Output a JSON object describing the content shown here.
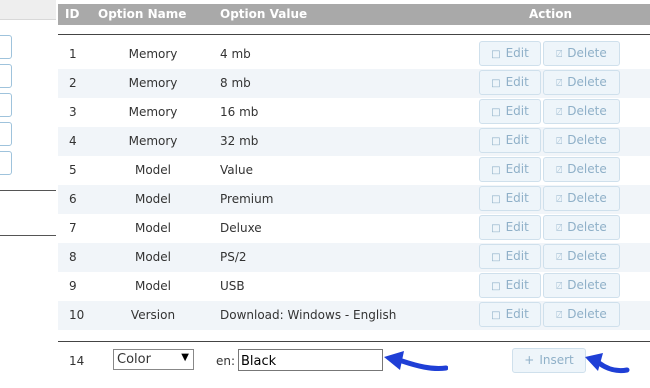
{
  "header": {
    "id": "ID",
    "option_name": "Option Name",
    "option_value": "Option Value",
    "action": "Action"
  },
  "rows": [
    {
      "id": "1",
      "name": "Memory",
      "value": "4 mb",
      "edit": "Edit",
      "delete": "Delete"
    },
    {
      "id": "2",
      "name": "Memory",
      "value": "8 mb",
      "edit": "Edit",
      "delete": "Delete"
    },
    {
      "id": "3",
      "name": "Memory",
      "value": "16 mb",
      "edit": "Edit",
      "delete": "Delete"
    },
    {
      "id": "4",
      "name": "Memory",
      "value": "32 mb",
      "edit": "Edit",
      "delete": "Delete"
    },
    {
      "id": "5",
      "name": "Model",
      "value": "Value",
      "edit": "Edit",
      "delete": "Delete"
    },
    {
      "id": "6",
      "name": "Model",
      "value": "Premium",
      "edit": "Edit",
      "delete": "Delete"
    },
    {
      "id": "7",
      "name": "Model",
      "value": "Deluxe",
      "edit": "Edit",
      "delete": "Delete"
    },
    {
      "id": "8",
      "name": "Model",
      "value": "PS/2",
      "edit": "Edit",
      "delete": "Delete"
    },
    {
      "id": "9",
      "name": "Model",
      "value": "USB",
      "edit": "Edit",
      "delete": "Delete"
    },
    {
      "id": "10",
      "name": "Version",
      "value": "Download: Windows - English",
      "edit": "Edit",
      "delete": "Delete"
    }
  ],
  "insert_row": {
    "id": "14",
    "option_select": "Color",
    "lang_label": "en:",
    "value_input": "Black",
    "insert_label": "Insert"
  },
  "icons": {
    "edit": "document-icon",
    "delete": "trash-icon",
    "insert": "plus-icon",
    "arrow": "pointer-arrow-icon"
  },
  "colors": {
    "header_bg": "#a9a9a9",
    "button_text": "#8fb0c8",
    "arrow": "#1f3fd6"
  }
}
